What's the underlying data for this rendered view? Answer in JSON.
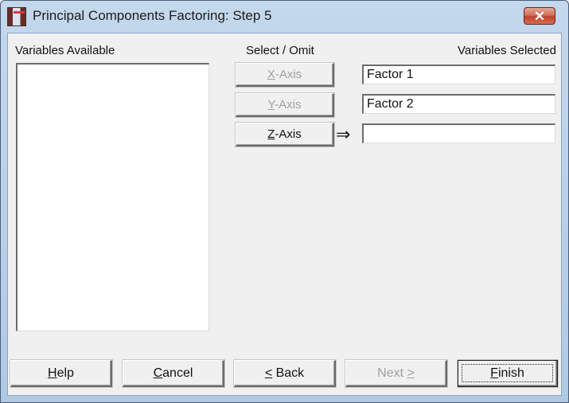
{
  "window": {
    "title": "Principal Components Factoring: Step 5",
    "icon": "app-icon",
    "close_glyph": "✕"
  },
  "variables_available": {
    "label": "Variables Available",
    "items": []
  },
  "select_omit": {
    "label": "Select / Omit",
    "buttons": [
      {
        "mnemonic": "X",
        "rest": "-Axis",
        "enabled": false
      },
      {
        "mnemonic": "Y",
        "rest": "-Axis",
        "enabled": false
      },
      {
        "mnemonic": "Z",
        "rest": "-Axis",
        "enabled": true
      }
    ],
    "arrow_glyph": "⇒"
  },
  "variables_selected": {
    "label": "Variables Selected",
    "fields": [
      {
        "value": "Factor 1"
      },
      {
        "value": "Factor 2"
      },
      {
        "value": ""
      }
    ]
  },
  "footer": {
    "help": {
      "mnemonic": "H",
      "rest": "elp"
    },
    "cancel": {
      "mnemonic": "C",
      "rest": "ancel"
    },
    "back": {
      "mnemonic": "<",
      "rest": " Back"
    },
    "next": {
      "pre": "Next ",
      "mnemonic": ">",
      "enabled": false
    },
    "finish": {
      "mnemonic": "F",
      "rest": "inish"
    }
  }
}
